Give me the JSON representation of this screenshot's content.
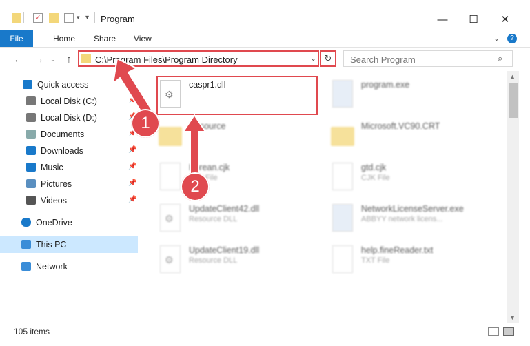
{
  "window": {
    "title": "Program",
    "help": "?"
  },
  "ribbon": {
    "tabs": [
      "File",
      "Home",
      "Share",
      "View"
    ]
  },
  "address": {
    "path": "C:\\Program Files\\Program Directory"
  },
  "search": {
    "placeholder": "Search Program"
  },
  "nav": {
    "items": [
      {
        "label": "Quick access",
        "icon": "star-icon",
        "pinned": false
      },
      {
        "label": "Local Disk (C:)",
        "icon": "drive-icon",
        "pinned": true
      },
      {
        "label": "Local Disk (D:)",
        "icon": "drive-icon",
        "pinned": true
      },
      {
        "label": "Documents",
        "icon": "documents-icon",
        "pinned": true
      },
      {
        "label": "Downloads",
        "icon": "download-icon",
        "pinned": true
      },
      {
        "label": "Music",
        "icon": "music-icon",
        "pinned": true
      },
      {
        "label": "Pictures",
        "icon": "pictures-icon",
        "pinned": true
      },
      {
        "label": "Videos",
        "icon": "videos-icon",
        "pinned": true
      },
      {
        "label": "OneDrive",
        "icon": "cloud-icon",
        "pinned": false
      },
      {
        "label": "This PC",
        "icon": "pc-icon",
        "pinned": false,
        "selected": true
      },
      {
        "label": "Network",
        "icon": "network-icon",
        "pinned": false
      }
    ]
  },
  "files": [
    {
      "name": "caspr1.dll",
      "sub": ""
    },
    {
      "name": "program.exe",
      "sub": ""
    },
    {
      "name": "Resource",
      "sub": ""
    },
    {
      "name": "Microsoft.VC90.CRT",
      "sub": ""
    },
    {
      "name": "Korean.cjk",
      "sub": "CJK File"
    },
    {
      "name": "gtd.cjk",
      "sub": "CJK File"
    },
    {
      "name": "UpdateClient42.dll",
      "sub": "Resource DLL"
    },
    {
      "name": "NetworkLicenseServer.exe",
      "sub": "ABBYY network licens..."
    },
    {
      "name": "UpdateClient19.dll",
      "sub": "Resource DLL"
    },
    {
      "name": "help.fineReader.txt",
      "sub": "TXT File"
    }
  ],
  "callouts": {
    "step1": "1",
    "step2": "2"
  },
  "status": {
    "count": "105 items"
  },
  "colors": {
    "accent": "#1979ca",
    "callout": "#e0494f",
    "selection": "#cce8ff"
  }
}
